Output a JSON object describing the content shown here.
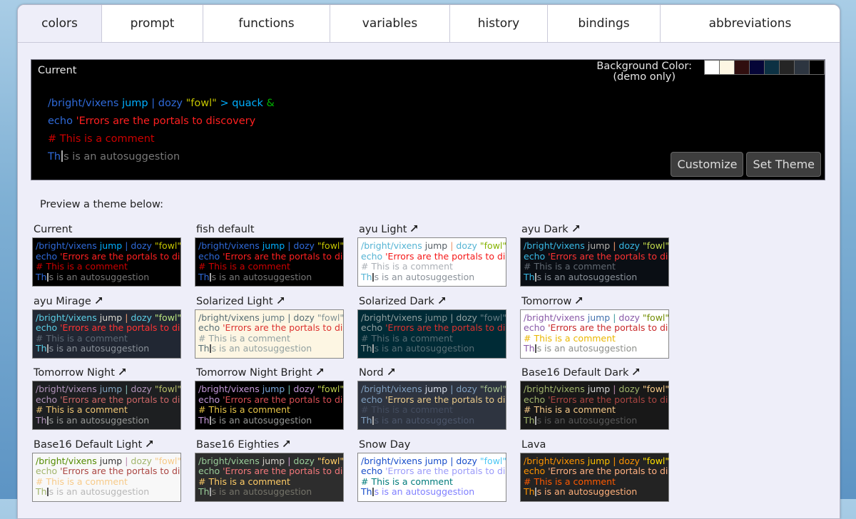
{
  "tabs": [
    {
      "label": "colors",
      "width": 117,
      "active": true
    },
    {
      "label": "prompt",
      "width": 142
    },
    {
      "label": "functions",
      "width": 178
    },
    {
      "label": "variables",
      "width": 168
    },
    {
      "label": "history",
      "width": 137
    },
    {
      "label": "bindings",
      "width": 158
    },
    {
      "label": "abbreviations",
      "width": 252
    }
  ],
  "current_panel": {
    "label": "Current",
    "bg_label_line1": "Background Color:",
    "bg_label_line2": "(demo only)",
    "swatches": [
      "#ffffff",
      "#fdf6e3",
      "#300e0e",
      "#050537",
      "#0c3143",
      "#252525",
      "#2d3540",
      "#000000"
    ],
    "customize_label": "Customize",
    "set_theme_label": "Set Theme"
  },
  "preview_label": "Preview a theme below:",
  "sample_text": {
    "cmd": "/bright/vixens",
    "param1": " jump",
    "pipe": " |",
    "cmd2": " dozy",
    "quote": " \"fowl\"",
    "redir": " >",
    "param2": " quack",
    "end": " &",
    "echo": "echo",
    "err": " 'Errors are the portals to discovery",
    "comment": "# This is a comment",
    "auto_pre": "Th",
    "auto_post": "s is an autosuggestion"
  },
  "current_colors": {
    "bg": "#000000",
    "cmd": "#2f6ad9",
    "param": "#00afff",
    "pipe": "#2f6ad9",
    "cmd2": "#2f6ad9",
    "quote": "#c4c400",
    "redir": "#00afff",
    "param2": "#00afff",
    "end": "#00b000",
    "echo": "#2f6ad9",
    "err": "#ff2020",
    "comment": "#cc0000",
    "auto_pre": "#2f6ad9",
    "auto": "#777777",
    "cursor": "#aaaaaa"
  },
  "themes": [
    {
      "name": "Current",
      "arrow": false,
      "colors": {
        "bg": "#000000",
        "cmd": "#2f6ad9",
        "param": "#00afff",
        "pipe": "#2f6ad9",
        "cmd2": "#2f6ad9",
        "quote": "#c4c400",
        "redir": "#00afff",
        "param2": "#00afff",
        "end": "#00b000",
        "echo": "#2f6ad9",
        "err": "#ff2020",
        "comment": "#cc0000",
        "auto_pre": "#2f6ad9",
        "auto": "#777777",
        "cursor": "#aaaaaa"
      }
    },
    {
      "name": "fish default",
      "arrow": false,
      "colors": {
        "bg": "#000000",
        "cmd": "#2f6ad9",
        "param": "#00afff",
        "pipe": "#2f6ad9",
        "cmd2": "#2f6ad9",
        "quote": "#c4c400",
        "redir": "#00afff",
        "param2": "#00afff",
        "end": "#00b000",
        "echo": "#2f6ad9",
        "err": "#ff2020",
        "comment": "#cc0000",
        "auto_pre": "#2f6ad9",
        "auto": "#777777",
        "cursor": "#aaaaaa"
      }
    },
    {
      "name": "ayu Light",
      "arrow": true,
      "colors": {
        "bg": "#ffffff",
        "cmd": "#55b4d4",
        "param": "#575f66",
        "pipe": "#ed9366",
        "cmd2": "#55b4d4",
        "quote": "#86b300",
        "redir": "#55b4d4",
        "param2": "#575f66",
        "end": "#575f66",
        "echo": "#55b4d4",
        "err": "#f51818",
        "comment": "#abb0b6",
        "auto_pre": "#55b4d4",
        "auto": "#8a9199",
        "cursor": "#555555"
      }
    },
    {
      "name": "ayu Dark",
      "arrow": true,
      "colors": {
        "bg": "#0a0e14",
        "cmd": "#39bae6",
        "param": "#b3b1ad",
        "pipe": "#f29668",
        "cmd2": "#39bae6",
        "quote": "#c2d94c",
        "redir": "#39bae6",
        "param2": "#b3b1ad",
        "end": "#b3b1ad",
        "echo": "#39bae6",
        "err": "#ff3333",
        "comment": "#626a73",
        "auto_pre": "#39bae6",
        "auto": "#8a9199",
        "cursor": "#aaaaaa"
      }
    },
    {
      "name": "ayu Mirage",
      "arrow": true,
      "colors": {
        "bg": "#212733",
        "cmd": "#5ccfe6",
        "param": "#d9d7ce",
        "pipe": "#f29e74",
        "cmd2": "#5ccfe6",
        "quote": "#bae67e",
        "redir": "#5ccfe6",
        "param2": "#d9d7ce",
        "end": "#d9d7ce",
        "echo": "#5ccfe6",
        "err": "#ff3333",
        "comment": "#5c6773",
        "auto_pre": "#5ccfe6",
        "auto": "#8a9199",
        "cursor": "#aaaaaa"
      }
    },
    {
      "name": "Solarized Light",
      "arrow": true,
      "colors": {
        "bg": "#fdf6e3",
        "cmd": "#586e75",
        "param": "#657b83",
        "pipe": "#586e75",
        "cmd2": "#586e75",
        "quote": "#839496",
        "redir": "#586e75",
        "param2": "#657b83",
        "end": "#657b83",
        "echo": "#586e75",
        "err": "#dc322f",
        "comment": "#93a1a1",
        "auto_pre": "#586e75",
        "auto": "#93a1a1",
        "cursor": "#555555"
      }
    },
    {
      "name": "Solarized Dark",
      "arrow": true,
      "colors": {
        "bg": "#002b36",
        "cmd": "#93a1a1",
        "param": "#839496",
        "pipe": "#93a1a1",
        "cmd2": "#93a1a1",
        "quote": "#657b83",
        "redir": "#93a1a1",
        "param2": "#839496",
        "end": "#839496",
        "echo": "#93a1a1",
        "err": "#dc322f",
        "comment": "#586e75",
        "auto_pre": "#93a1a1",
        "auto": "#586e75",
        "cursor": "#aaaaaa"
      }
    },
    {
      "name": "Tomorrow",
      "arrow": true,
      "colors": {
        "bg": "#ffffff",
        "cmd": "#8959a8",
        "param": "#4271ae",
        "pipe": "#3e999f",
        "cmd2": "#8959a8",
        "quote": "#718c00",
        "redir": "#3e999f",
        "param2": "#4271ae",
        "end": "#4271ae",
        "echo": "#8959a8",
        "err": "#c82829",
        "comment": "#eab700",
        "auto_pre": "#8959a8",
        "auto": "#8e908c",
        "cursor": "#555555"
      }
    },
    {
      "name": "Tomorrow Night",
      "arrow": true,
      "colors": {
        "bg": "#1d1f21",
        "cmd": "#b294bb",
        "param": "#81a2be",
        "pipe": "#8abeb7",
        "cmd2": "#b294bb",
        "quote": "#b5bd68",
        "redir": "#8abeb7",
        "param2": "#81a2be",
        "end": "#81a2be",
        "echo": "#b294bb",
        "err": "#cc6666",
        "comment": "#f0c674",
        "auto_pre": "#b294bb",
        "auto": "#969896",
        "cursor": "#aaaaaa"
      }
    },
    {
      "name": "Tomorrow Night Bright",
      "arrow": true,
      "colors": {
        "bg": "#000000",
        "cmd": "#c397d8",
        "param": "#7aa6da",
        "pipe": "#70c0b1",
        "cmd2": "#c397d8",
        "quote": "#b9ca4a",
        "redir": "#70c0b1",
        "param2": "#7aa6da",
        "end": "#7aa6da",
        "echo": "#c397d8",
        "err": "#d54e53",
        "comment": "#e7c547",
        "auto_pre": "#c397d8",
        "auto": "#969896",
        "cursor": "#aaaaaa"
      }
    },
    {
      "name": "Nord",
      "arrow": true,
      "colors": {
        "bg": "#2e3440",
        "cmd": "#81a1c1",
        "param": "#d8dee9",
        "pipe": "#81a1c1",
        "cmd2": "#81a1c1",
        "quote": "#a3be8c",
        "redir": "#81a1c1",
        "param2": "#d8dee9",
        "end": "#d8dee9",
        "echo": "#81a1c1",
        "err": "#ebcb8b",
        "comment": "#434c5e",
        "auto_pre": "#81a1c1",
        "auto": "#4c566a",
        "cursor": "#aaaaaa"
      }
    },
    {
      "name": "Base16 Default Dark",
      "arrow": true,
      "colors": {
        "bg": "#181818",
        "cmd": "#a1b56c",
        "param": "#d8d8d8",
        "pipe": "#ba8baf",
        "cmd2": "#a1b56c",
        "quote": "#f7ca88",
        "redir": "#ba8baf",
        "param2": "#d8d8d8",
        "end": "#d8d8d8",
        "echo": "#a1b56c",
        "err": "#ab4642",
        "comment": "#f7ca88",
        "auto_pre": "#a1b56c",
        "auto": "#585858",
        "cursor": "#aaaaaa"
      }
    },
    {
      "name": "Base16 Default Light",
      "arrow": true,
      "colors": {
        "bg": "#f8f8f8",
        "cmd": "#538b01",
        "param": "#383838",
        "pipe": "#ba8baf",
        "cmd2": "#a1b56c",
        "quote": "#f7ca88",
        "redir": "#ba8baf",
        "param2": "#383838",
        "end": "#383838",
        "echo": "#a1b56c",
        "err": "#ab4642",
        "comment": "#f7ca88",
        "auto_pre": "#a1b56c",
        "auto": "#b8b8b8",
        "cursor": "#555555"
      }
    },
    {
      "name": "Base16 Eighties",
      "arrow": true,
      "colors": {
        "bg": "#2d2d2d",
        "cmd": "#99cc99",
        "param": "#d3d0c8",
        "pipe": "#cc99cc",
        "cmd2": "#99cc99",
        "quote": "#ffcc66",
        "redir": "#cc99cc",
        "param2": "#d3d0c8",
        "end": "#d3d0c8",
        "echo": "#99cc99",
        "err": "#f2777a",
        "comment": "#ffcc66",
        "auto_pre": "#99cc99",
        "auto": "#747369",
        "cursor": "#aaaaaa"
      }
    },
    {
      "name": "Snow Day",
      "arrow": false,
      "colors": {
        "bg": "#ffffff",
        "cmd": "#164cc9",
        "param": "#164cc9",
        "pipe": "#164cc9",
        "cmd2": "#164cc9",
        "quote": "#4dc7f4",
        "redir": "#164cc9",
        "param2": "#164cc9",
        "end": "#164cc9",
        "echo": "#164cc9",
        "err": "#9b9bfa",
        "comment": "#007b7b",
        "auto_pre": "#164cc9",
        "auto": "#7f7fff",
        "cursor": "#555555"
      }
    },
    {
      "name": "Lava",
      "arrow": false,
      "colors": {
        "bg": "#232323",
        "cmd": "#ff9400",
        "param": "#ffc000",
        "pipe": "#ff9400",
        "cmd2": "#ff9400",
        "quote": "#ffe000",
        "redir": "#ff9400",
        "param2": "#ffc000",
        "end": "#ffc000",
        "echo": "#ff9400",
        "err": "#ffb080",
        "comment": "#ff5a00",
        "auto_pre": "#ff9400",
        "auto": "#ffb07b",
        "cursor": "#aaaaaa"
      }
    }
  ]
}
